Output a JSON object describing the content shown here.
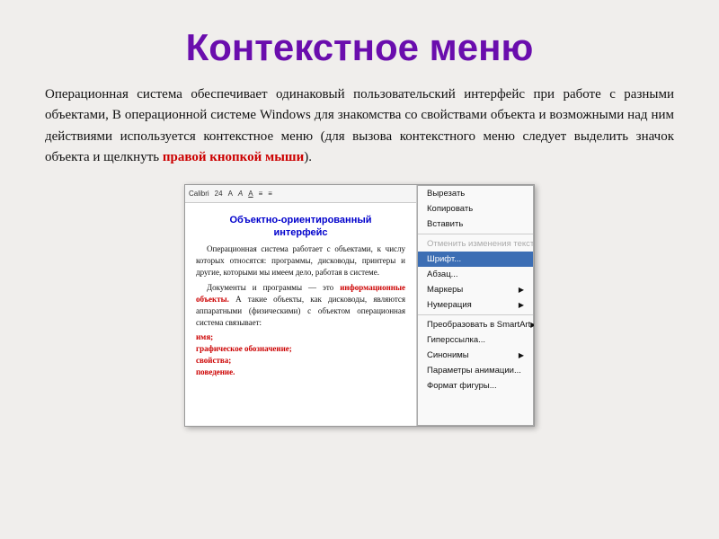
{
  "slide": {
    "title": "Контекстное меню",
    "body_text_part1": "Операционная система обеспечивает одинаковый пользовательский интерфейс при работе с разными объектами, В операционной системе Windows для знакомства со свойствами объекта и возможными над ним действиями используется контекстное меню (для вызова контекстного меню следует выделить значок объекта и щелкнуть ",
    "highlight": "правой кнопкой мыши",
    "body_text_part2": ").",
    "doc_title_line1": "Объектно-ориентированный",
    "doc_title_line2": "интерфейс",
    "doc_para1": "Операционная система работает с объектами, к числу которых относятся: программы, дисководы, принтеры и другие, которыми мы имеем дело, работая в системе.",
    "doc_para2": "Документы и программы — это информационные объекты. А такие объекты, как дисководы, являются аппаратными (физическими) с объектом операционная система связывает:",
    "doc_list": [
      "имя;",
      "графическое обозначение;",
      "свойства;",
      "поведение."
    ],
    "toolbar": {
      "font": "Calibri",
      "size": "24",
      "items": [
        "A",
        "A",
        "Aa",
        "A"
      ]
    },
    "context_menu": {
      "items": [
        {
          "label": "Вырезать",
          "disabled": false,
          "has_arrow": false,
          "highlighted": false
        },
        {
          "label": "Копировать",
          "disabled": false,
          "has_arrow": false,
          "highlighted": false
        },
        {
          "label": "Вставить",
          "disabled": false,
          "has_arrow": false,
          "highlighted": false
        },
        {
          "label": "Отменить изменения текста",
          "disabled": true,
          "has_arrow": false,
          "highlighted": false
        },
        {
          "label": "Шрифт...",
          "disabled": false,
          "has_arrow": false,
          "highlighted": true
        },
        {
          "label": "Абзац...",
          "disabled": false,
          "has_arrow": false,
          "highlighted": false
        },
        {
          "label": "Маркеры",
          "disabled": false,
          "has_arrow": true,
          "highlighted": false
        },
        {
          "label": "Нумерация",
          "disabled": false,
          "has_arrow": true,
          "highlighted": false
        },
        {
          "label": "Преобразовать в SmartArt",
          "disabled": false,
          "has_arrow": true,
          "highlighted": false
        },
        {
          "label": "Гиперссылка...",
          "disabled": false,
          "has_arrow": false,
          "highlighted": false
        },
        {
          "label": "Синонимы",
          "disabled": false,
          "has_arrow": true,
          "highlighted": false
        },
        {
          "label": "Параметры анимации...",
          "disabled": false,
          "has_arrow": false,
          "highlighted": false
        },
        {
          "label": "Формат фигуры...",
          "disabled": false,
          "has_arrow": false,
          "highlighted": false
        }
      ]
    }
  }
}
